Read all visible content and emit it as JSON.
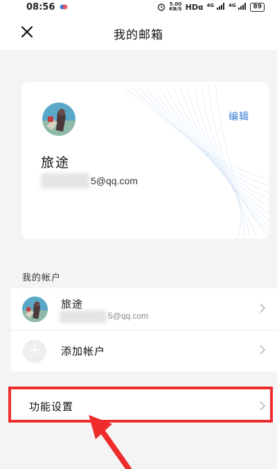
{
  "status_bar": {
    "time": "08:56",
    "speed_value": "5.00",
    "speed_unit": "KB/S",
    "hd_label": "HDα",
    "signal_1": "4G",
    "signal_2": "4G",
    "battery": "89"
  },
  "nav": {
    "title": "我的邮箱",
    "close_icon": "close-icon"
  },
  "profile": {
    "edit_label": "编辑",
    "name": "旅途",
    "email_visible": "5@qq.com"
  },
  "accounts": {
    "section_label": "我的帐户",
    "items": [
      {
        "name": "旅途",
        "email_visible": "5@qq.com"
      }
    ],
    "add_label": "添加帐户"
  },
  "settings": {
    "label": "功能设置"
  },
  "colors": {
    "accent": "#3a7bd5",
    "highlight": "#ee2c2c",
    "background": "#f4f4f4"
  }
}
